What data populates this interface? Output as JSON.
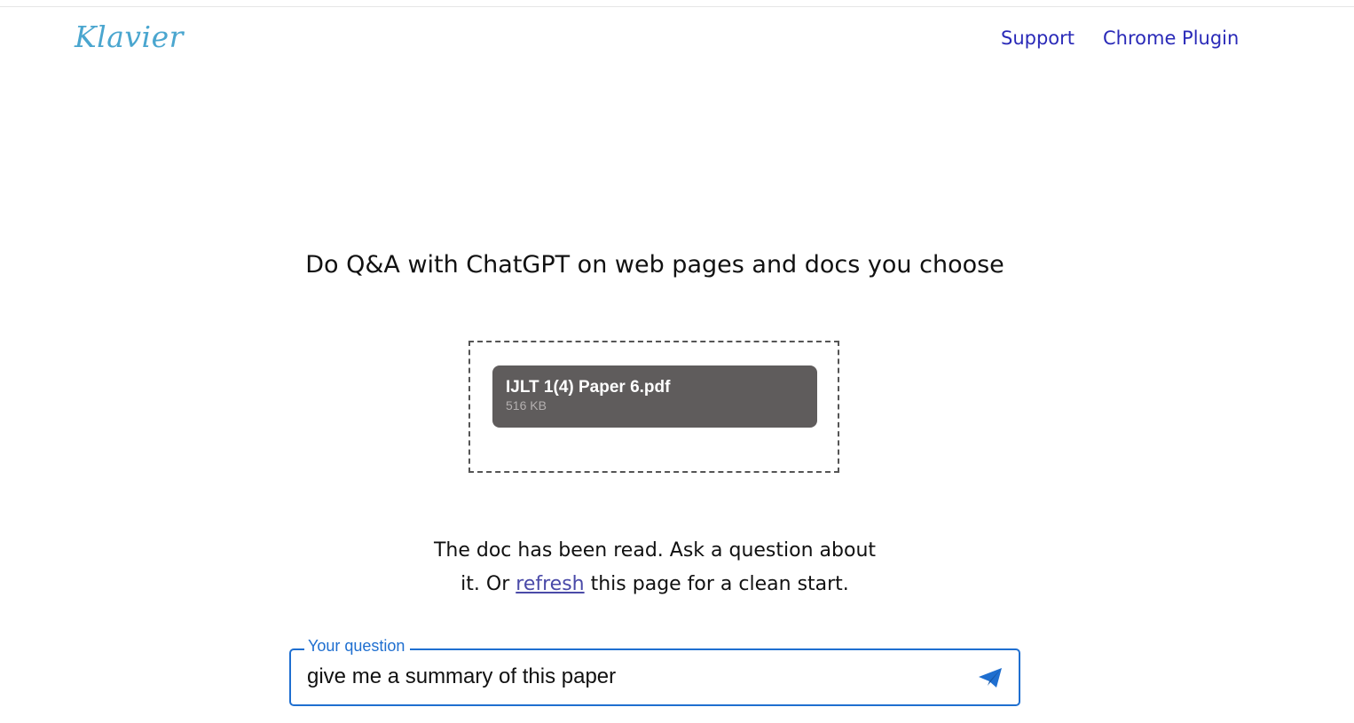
{
  "header": {
    "logo_text": "Klavier",
    "nav": {
      "support_label": "Support",
      "plugin_label": "Chrome Plugin"
    }
  },
  "main": {
    "headline": "Do Q&A with ChatGPT on web pages and docs you choose",
    "file": {
      "name": "IJLT 1(4) Paper 6.pdf",
      "size": "516 KB"
    },
    "status": {
      "before_link": "The doc has been read. Ask a question about it. Or",
      "link_text": "refresh",
      "after_link": "this page for a clean start."
    },
    "question": {
      "label": "Your question",
      "value": "give me a summary of this paper",
      "send_icon": "send-icon"
    }
  },
  "colors": {
    "logo": "#4aa6cf",
    "nav_link": "#2a2ab8",
    "focus_accent": "#1f6fd0",
    "file_card": "#5f5c5c",
    "refresh_link": "#4a4aa8"
  }
}
